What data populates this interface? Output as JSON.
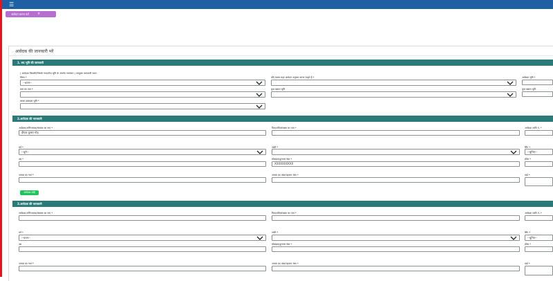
{
  "topbar": {
    "menu_icon": "hamburger-icon",
    "color": "#1f5fa3"
  },
  "chip": {
    "label": "आवेदन करना करें",
    "close": "×",
    "color": "#b570cf"
  },
  "card": {
    "title": "आवेदक की जानकारी भरें"
  },
  "section1": {
    "header": "1. सद भूमि की जानकारी",
    "note": "( आवेदक जिसकी/जिसके नाम/मौज भूमि के अंतर्गत नामांकन ) उपयुक्त जानकारी चयन",
    "district_label": "जिला *",
    "district_value": "--चयन--",
    "tehsil_question_label": "यदि रकबा कहां आवेदन अनुसार करना चाहते हैं *",
    "land_label": "आवेदक भूमि *",
    "village_label": "ग्राम का नाम *",
    "khasra_label": "कुल खसरा भूमि",
    "total_area_label": "कुल खसरा भूमि",
    "mapped_label": "रकबा हस्ताक्षर भूमि *"
  },
  "section2": {
    "header": "2.आवेदक की जानकारी",
    "applicant_label": "आवेदक/अभिभावक/संरक्षक का नाम *",
    "applicant_value": "दीपक कुमार गोड़",
    "father_label": "पिता/पति/संरक्षक का नाम *",
    "caste_label": "आवेदक जाति नं. *",
    "gender_label": "वर्ग *",
    "gender_value": "--चुने--",
    "category_label": "जाति *",
    "dob_label": "लिंग *",
    "dob_value": "--चुनिए--",
    "age_label": "उम्र *",
    "mobile_label": "मोबाइल/दूरभाष नंबर *",
    "mobile_value": "XXXXXXXXXX",
    "email_label": "ईमेल *",
    "aadhaar_label": "आधार का नाम *",
    "aadhaar2_label": "आधार का नंबर/पहचान नंबर *",
    "ward_label": "वार्ड *",
    "add_button": "आवेदक जोड़ें"
  },
  "section3": {
    "header": "3.आवेदक की जानकारी",
    "applicant_label": "आवेदक/अभिभावक/संरक्षक का नाम *",
    "father_label": "पिता/पति/संरक्षक का नाम *",
    "caste_label": "आवेदक जाति नं. *",
    "gender_label": "वर्ग *",
    "gender_value": "--चयन--",
    "category_label": "जाति *",
    "dob_label": "लिंग *",
    "dob_value": "--चुनिए--",
    "age_label": "उम्र",
    "mobile_label": "मोबाइल/दूरभाष नंबर *",
    "email_label": "ईमेल *",
    "aadhaar_label": "आधार का नाम *",
    "aadhaar2_label": "आधार का नंबर/पहचान नंबर *",
    "ward_label": "वार्ड *"
  }
}
